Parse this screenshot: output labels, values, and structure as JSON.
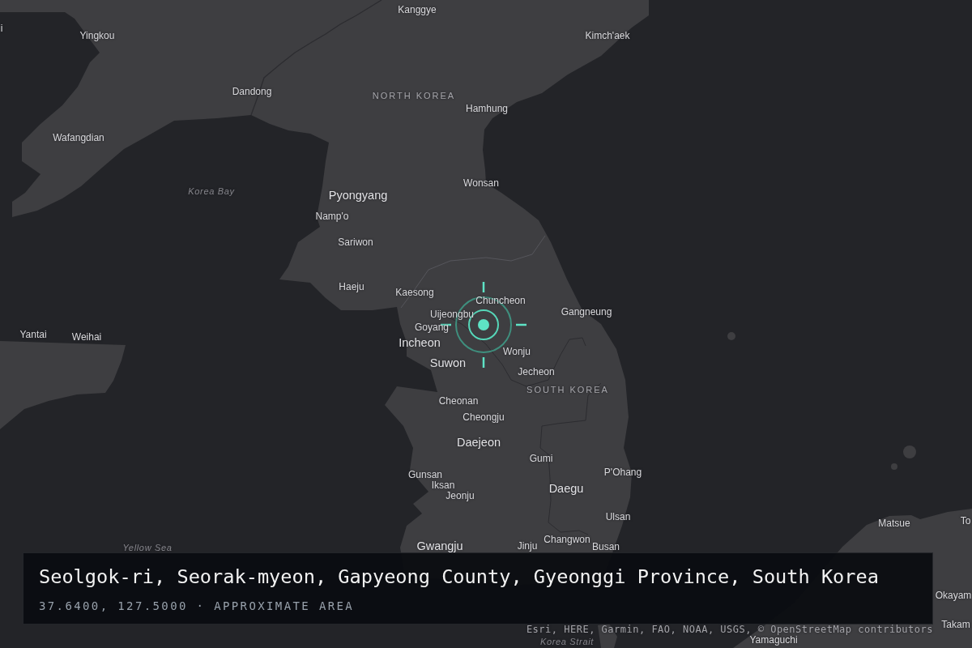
{
  "map": {
    "labels": [
      {
        "text": "Kanggye",
        "kind": "city"
      },
      {
        "text": "i",
        "kind": "city"
      },
      {
        "text": "Yingkou",
        "kind": "city"
      },
      {
        "text": "Kimch'aek",
        "kind": "city"
      },
      {
        "text": "Dandong",
        "kind": "city"
      },
      {
        "text": "NORTH KOREA",
        "kind": "country"
      },
      {
        "text": "Hamhung",
        "kind": "city"
      },
      {
        "text": "Wafangdian",
        "kind": "city"
      },
      {
        "text": "Wonsan",
        "kind": "city"
      },
      {
        "text": "Korea Bay",
        "kind": "water"
      },
      {
        "text": "Pyongyang",
        "kind": "major"
      },
      {
        "text": "Namp'o",
        "kind": "city"
      },
      {
        "text": "Sariwon",
        "kind": "city"
      },
      {
        "text": "Haeju",
        "kind": "city"
      },
      {
        "text": "Kaesong",
        "kind": "city"
      },
      {
        "text": "Chuncheon",
        "kind": "city"
      },
      {
        "text": "Gangneung",
        "kind": "city"
      },
      {
        "text": "Uijeongbu",
        "kind": "city"
      },
      {
        "text": "Goyang",
        "kind": "city"
      },
      {
        "text": "Yantai",
        "kind": "city"
      },
      {
        "text": "Weihai",
        "kind": "city"
      },
      {
        "text": "Incheon",
        "kind": "major"
      },
      {
        "text": "Wonju",
        "kind": "city"
      },
      {
        "text": "Suwon",
        "kind": "major"
      },
      {
        "text": "Jecheon",
        "kind": "city"
      },
      {
        "text": "SOUTH KOREA",
        "kind": "country"
      },
      {
        "text": "Cheonan",
        "kind": "city"
      },
      {
        "text": "Cheongju",
        "kind": "city"
      },
      {
        "text": "Daejeon",
        "kind": "major"
      },
      {
        "text": "Gumi",
        "kind": "city"
      },
      {
        "text": "Gunsan",
        "kind": "city"
      },
      {
        "text": "P'Ohang",
        "kind": "city"
      },
      {
        "text": "Iksan",
        "kind": "city"
      },
      {
        "text": "Daegu",
        "kind": "major"
      },
      {
        "text": "Jeonju",
        "kind": "city"
      },
      {
        "text": "Ulsan",
        "kind": "city"
      },
      {
        "text": "Matsue",
        "kind": "city"
      },
      {
        "text": "To",
        "kind": "city"
      },
      {
        "text": "Changwon",
        "kind": "city"
      },
      {
        "text": "Yellow Sea",
        "kind": "water"
      },
      {
        "text": "Gwangju",
        "kind": "major"
      },
      {
        "text": "Jinju",
        "kind": "city"
      },
      {
        "text": "Busan",
        "kind": "city"
      },
      {
        "text": "Okayam",
        "kind": "city"
      },
      {
        "text": "Takam",
        "kind": "city"
      },
      {
        "text": "Yamaguchi",
        "kind": "city"
      },
      {
        "text": "Korea Strait",
        "kind": "water"
      }
    ]
  },
  "location_card": {
    "title": "Seolgok-ri, Seorak-myeon, Gapyeong County, Gyeonggi Province, South Korea",
    "subtitle": "37.6400, 127.5000 · APPROXIMATE AREA"
  },
  "attribution": "Esri, HERE, Garmin, FAO, NOAA, USGS, © OpenStreetMap contributors"
}
